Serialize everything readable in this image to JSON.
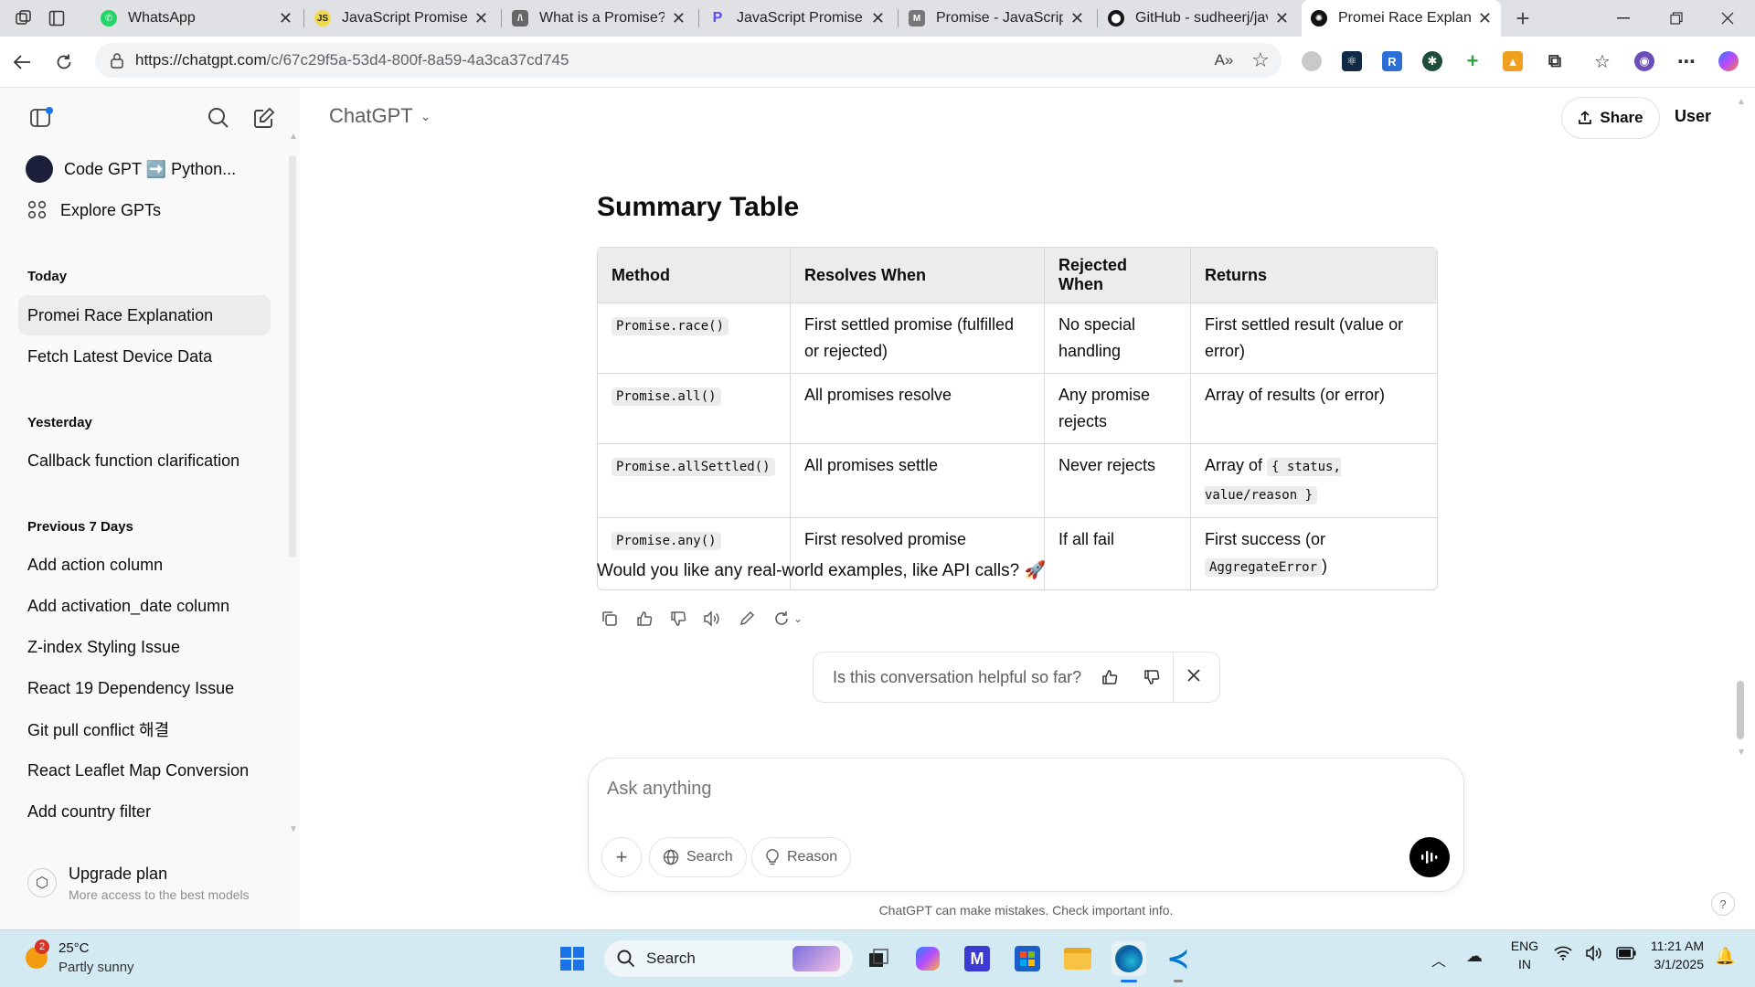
{
  "browser": {
    "tabs": [
      {
        "title": "WhatsApp",
        "favicon": "whatsapp-icon",
        "color": "#25d366"
      },
      {
        "title": "JavaScript Promises",
        "favicon": "js-icon",
        "color": "#f0db4f"
      },
      {
        "title": "What is a Promise? Ja",
        "favicon": "site-icon",
        "color": "#666666"
      },
      {
        "title": "JavaScript Promise an",
        "favicon": "site-icon",
        "color": "#5b4bff"
      },
      {
        "title": "Promise - JavaScript |",
        "favicon": "mdn-icon",
        "color": "#555555"
      },
      {
        "title": "GitHub - sudheerj/jav",
        "favicon": "github-icon",
        "color": "#181717"
      },
      {
        "title": "Promei Race Explanat",
        "favicon": "chatgpt-icon",
        "color": "#111111"
      }
    ],
    "url_host": "https://chatgpt.com",
    "url_path": "/c/67c29f5a-53d4-800f-8a59-4a3ca37cd745"
  },
  "sidebar": {
    "pinned": [
      {
        "label": "Code GPT ➡️ Python..."
      },
      {
        "label": "Explore GPTs"
      }
    ],
    "sections": [
      {
        "heading": "Today",
        "items": [
          "Promei Race Explanation",
          "Fetch Latest Device Data"
        ]
      },
      {
        "heading": "Yesterday",
        "items": [
          "Callback function clarification"
        ]
      },
      {
        "heading": "Previous 7 Days",
        "items": [
          "Add action column",
          "Add activation_date column",
          "Z-index Styling Issue",
          "React 19 Dependency Issue",
          "Git pull conflict 해결",
          "React Leaflet Map Conversion",
          "Add country filter"
        ]
      }
    ],
    "upgrade": {
      "title": "Upgrade plan",
      "subtitle": "More access to the best models"
    }
  },
  "header": {
    "model": "ChatGPT",
    "share_label": "Share",
    "user_label": "User"
  },
  "content": {
    "heading": "Summary Table",
    "table": {
      "headers": [
        "Method",
        "Resolves When",
        "Rejected When",
        "Returns"
      ],
      "rows": [
        {
          "method": "Promise.race()",
          "resolves": "First settled promise (fulfilled or rejected)",
          "rejected": "No special handling",
          "returns_text": "First settled result (value or error)",
          "returns_code": "",
          "returns_suffix": ""
        },
        {
          "method": "Promise.all()",
          "resolves": "All promises resolve",
          "rejected": "Any promise rejects",
          "returns_text": "Array of results (or error)",
          "returns_code": "",
          "returns_suffix": ""
        },
        {
          "method": "Promise.allSettled()",
          "resolves": "All promises settle",
          "rejected": "Never rejects",
          "returns_text": "Array of ",
          "returns_code": "{ status, value/reason }",
          "returns_suffix": ""
        },
        {
          "method": "Promise.any()",
          "resolves": "First resolved promise",
          "rejected": "If all fail",
          "returns_text": "First success (or ",
          "returns_code": "AggregateError",
          "returns_suffix": ")"
        }
      ]
    },
    "followup": "Would you like any real-world examples, like API calls? 🚀",
    "feedback_prompt": "Is this conversation helpful so far?"
  },
  "composer": {
    "placeholder": "Ask anything",
    "search_label": "Search",
    "reason_label": "Reason",
    "disclaimer": "ChatGPT can make mistakes. Check important info."
  },
  "taskbar": {
    "weather_temp": "25°C",
    "weather_desc": "Partly sunny",
    "weather_badge": "2",
    "search_label": "Search",
    "lang_top": "ENG",
    "lang_bottom": "IN",
    "time": "11:21 AM",
    "date": "3/1/2025"
  }
}
